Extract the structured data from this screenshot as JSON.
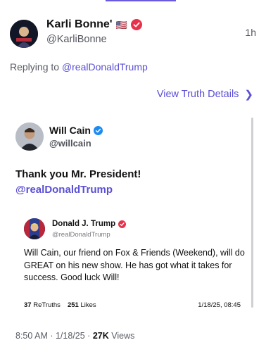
{
  "post": {
    "author_name": "Karli Bonne'",
    "author_flag": "🇺🇸",
    "author_handle": "@KarliBonne",
    "time_ago": "1h",
    "reply_prefix": "Replying to ",
    "reply_to": "@realDonaldTrump",
    "view_details_label": "View Truth Details",
    "icons": {
      "avatar": "avatar-image",
      "verified": "verified-badge-icon",
      "chevron": "chevron-right-icon"
    }
  },
  "quote": {
    "author_name": "Will Cain",
    "author_handle": "@willcain",
    "text_line1": "Thank you Mr. President!",
    "text_mention": "@realDonaldTrump",
    "inner": {
      "author_name": "Donald J. Trump",
      "author_handle": "@realDonaldTrump",
      "text": "Will Cain, our friend on Fox & Friends (Weekend), will do GREAT on his new show. He has got what it takes for success. Good luck Will!",
      "retruths_count": "37",
      "retruths_label": "ReTruths",
      "likes_count": "251",
      "likes_label": "Likes",
      "date": "1/18/25, 08:45"
    }
  },
  "footer": {
    "time": "8:50 AM",
    "sep1": " · ",
    "date": "1/18/25",
    "sep2": " · ",
    "views_count": "27K",
    "views_label": " Views"
  },
  "colors": {
    "accent": "#5a4fd6",
    "verified_badge": "#e8314b",
    "verified_blue": "#1d8bf1"
  }
}
